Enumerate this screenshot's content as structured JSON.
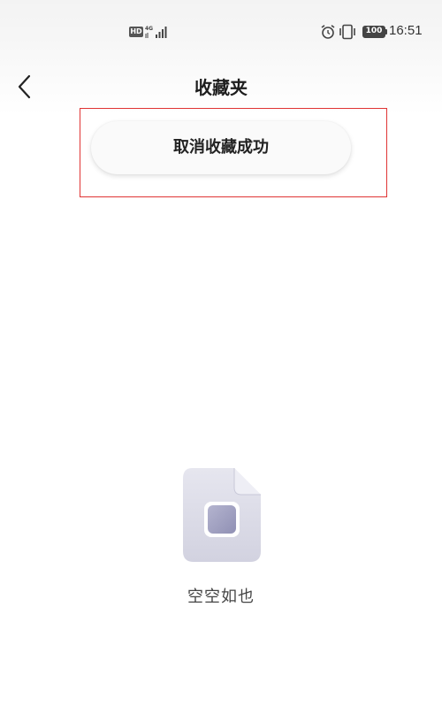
{
  "status_bar": {
    "hd": "HD",
    "network": "4G",
    "battery": "100",
    "time": "16:51"
  },
  "header": {
    "title": "收藏夹",
    "back_icon": "chevron-left-icon"
  },
  "toast": {
    "message": "取消收藏成功"
  },
  "empty_state": {
    "icon": "empty-file-icon",
    "text": "空空如也"
  },
  "colors": {
    "highlight": "#e03434",
    "icon_fill": "#d7d7e4",
    "icon_inner": "#9c9cbc"
  }
}
